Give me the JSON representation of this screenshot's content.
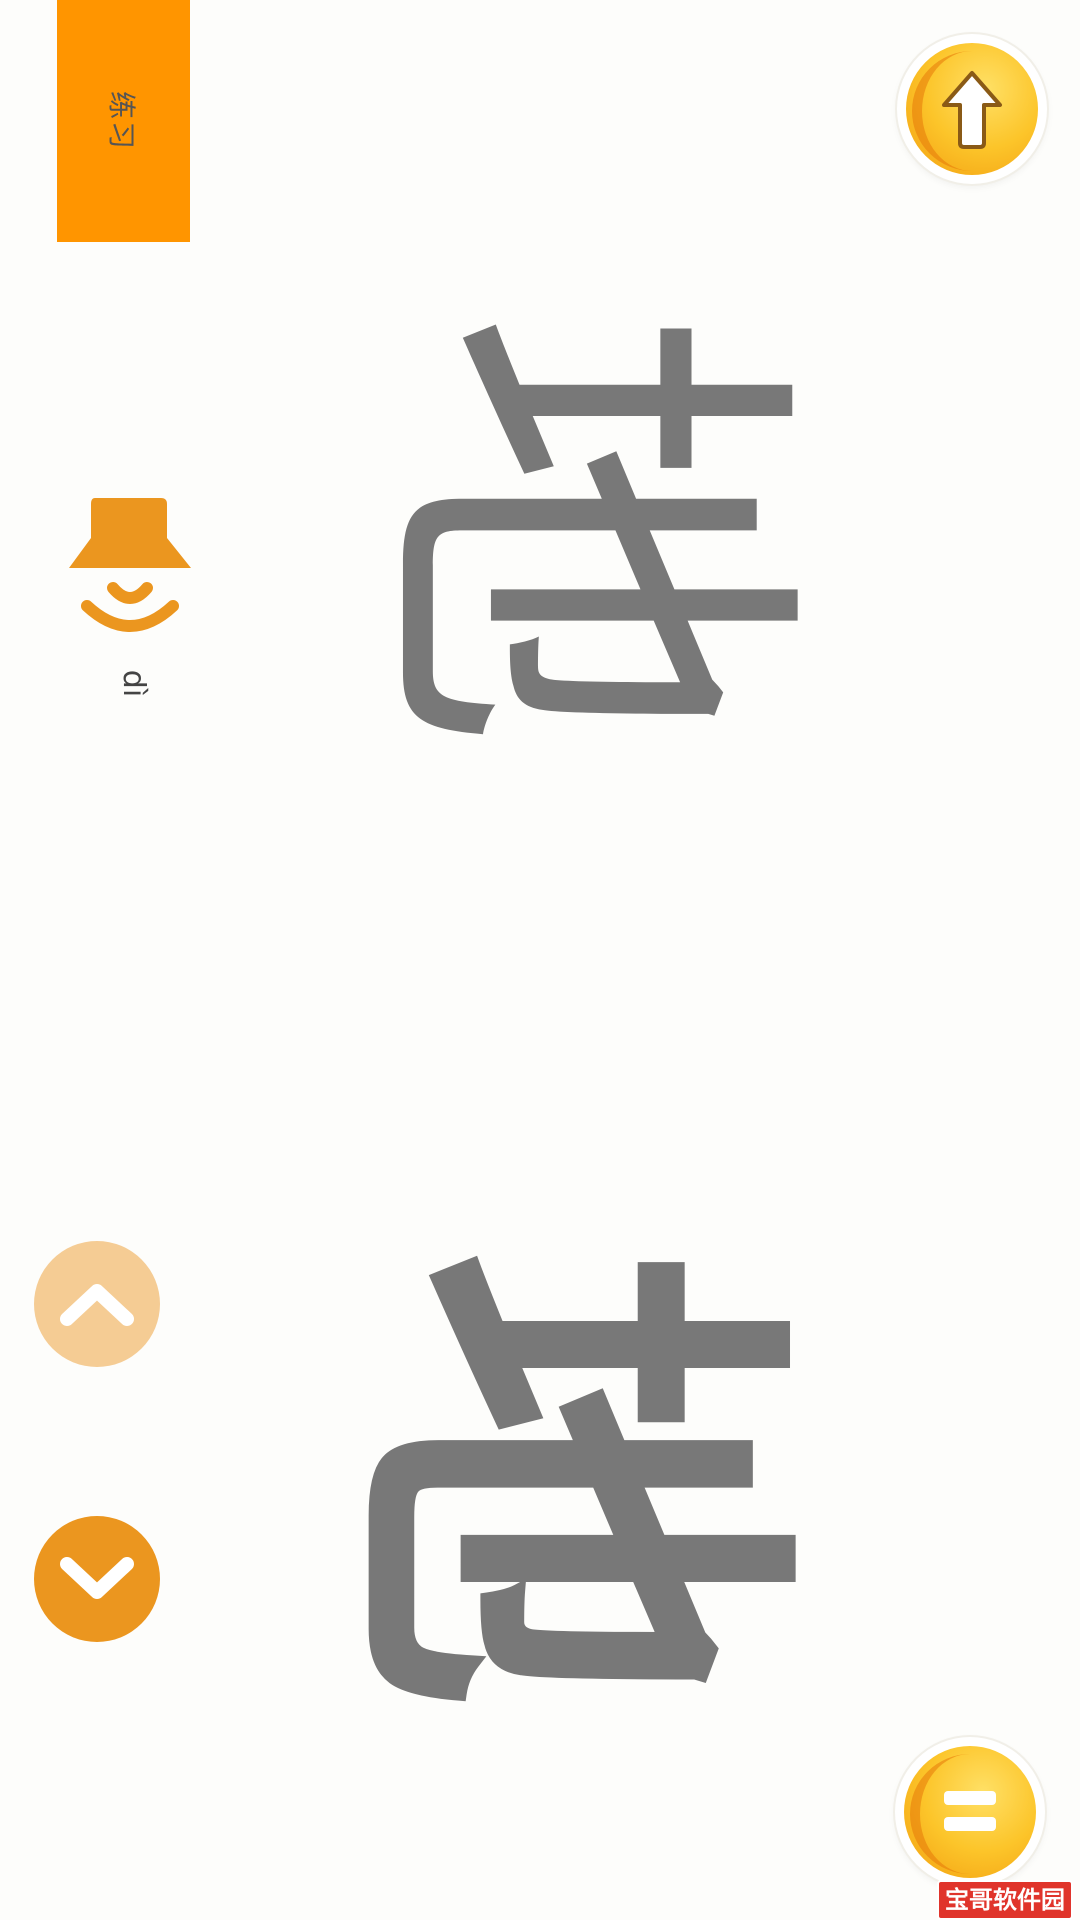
{
  "practice_tab": {
    "label": "练习"
  },
  "character": {
    "calligraphy": "地",
    "block": "地",
    "pinyin": "dì"
  },
  "colors": {
    "accent_orange": "#ff9500",
    "character_gray": "#787878",
    "nav_up_disabled": "#f5cc94",
    "nav_down": "#eb961f",
    "gold": "#fcc52a"
  },
  "icons": {
    "sound": "speaker-icon",
    "top_button": "arrow-up-icon",
    "bottom_button": "equals-icon",
    "nav_up": "chevron-up-icon",
    "nav_down": "chevron-down-icon"
  },
  "watermark": {
    "text": "宝哥软件园"
  }
}
